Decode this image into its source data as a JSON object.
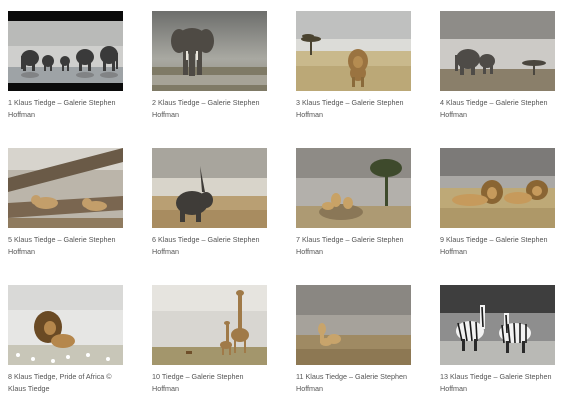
{
  "gallery": {
    "items": [
      {
        "caption": "1 Klaus Tiedge – Galerie Stephen Hoffman",
        "image": "elephant-herd-silhouette"
      },
      {
        "caption": "2 Klaus Tiedge – Galerie Stephen Hoffman",
        "image": "elephant-front"
      },
      {
        "caption": "3 Klaus Tiedge – Galerie Stephen Hoffman",
        "image": "lion-savanna-tree"
      },
      {
        "caption": "4 Klaus Tiedge – Galerie Stephen Hoffman",
        "image": "elephants-acacia"
      },
      {
        "caption": "5 Klaus Tiedge – Galerie Stephen Hoffman",
        "image": "lions-on-tree"
      },
      {
        "caption": "6 Klaus Tiedge – Galerie Stephen Hoffman",
        "image": "rhino"
      },
      {
        "caption": "7 Klaus Tiedge – Galerie Stephen Hoffman",
        "image": "lions-acacia-rock"
      },
      {
        "caption": "9 Klaus Tiedge – Galerie Stephen Hoffman",
        "image": "two-lions-grass"
      },
      {
        "caption": "8 Klaus Tiedge, Pride of Africa © Klaus Tiedge",
        "image": "lion-flowers"
      },
      {
        "caption": "10 Tiedge – Galerie Stephen Hoffman",
        "image": "giraffes"
      },
      {
        "caption": "11 Klaus Tiedge – Galerie Stephen Hoffman",
        "image": "cheetahs"
      },
      {
        "caption": "13 Klaus Tiedge – Galerie Stephen Hoffman",
        "image": "zebras"
      }
    ]
  }
}
